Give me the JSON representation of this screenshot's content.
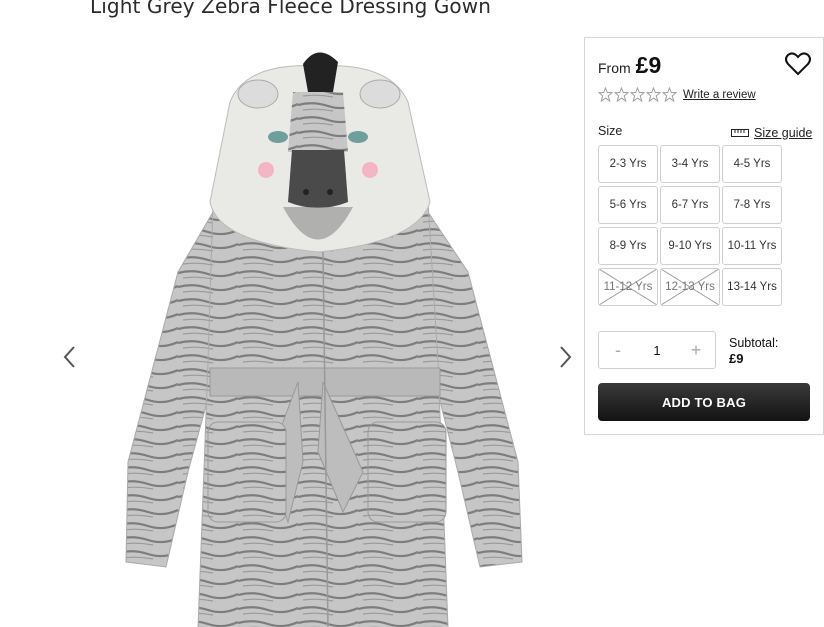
{
  "product": {
    "title": "Light Grey Zebra Fleece Dressing Gown",
    "image_alt": "zebra-fleece-dressing-gown-photo"
  },
  "gallery": {
    "prev_icon": "chevron-left-icon",
    "next_icon": "chevron-right-icon"
  },
  "price": {
    "from_label": "From",
    "value": "£9"
  },
  "rating": {
    "stars_filled": 0,
    "stars_total": 5,
    "review_link": "Write a review"
  },
  "size": {
    "label": "Size",
    "guide_label": "Size guide",
    "options": [
      {
        "label": "2-3 Yrs",
        "available": true
      },
      {
        "label": "3-4 Yrs",
        "available": true
      },
      {
        "label": "4-5 Yrs",
        "available": true
      },
      {
        "label": "5-6 Yrs",
        "available": true
      },
      {
        "label": "6-7 Yrs",
        "available": true
      },
      {
        "label": "7-8 Yrs",
        "available": true
      },
      {
        "label": "8-9 Yrs",
        "available": true
      },
      {
        "label": "9-10 Yrs",
        "available": true
      },
      {
        "label": "10-11 Yrs",
        "available": true
      },
      {
        "label": "11-12 Yrs",
        "available": false
      },
      {
        "label": "12-13 Yrs",
        "available": false
      },
      {
        "label": "13-14 Yrs",
        "available": true
      }
    ]
  },
  "quantity": {
    "minus": "-",
    "value": "1",
    "plus": "+"
  },
  "subtotal": {
    "label": "Subtotal:",
    "value": "£9"
  },
  "actions": {
    "add_to_bag": "ADD TO BAG"
  },
  "colors": {
    "button_dark": "#1f1f1f",
    "border": "#cfcfcf"
  }
}
